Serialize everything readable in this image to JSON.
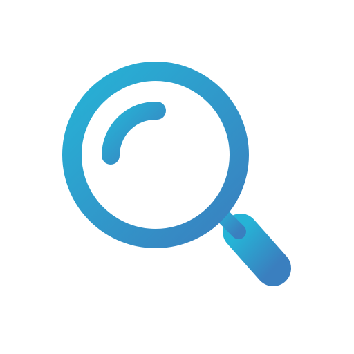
{
  "icon": {
    "name": "magnifying-glass-icon",
    "colors": {
      "gradient_start": "#26b3d6",
      "gradient_end": "#3a7fbf",
      "background": "#ffffff"
    }
  }
}
